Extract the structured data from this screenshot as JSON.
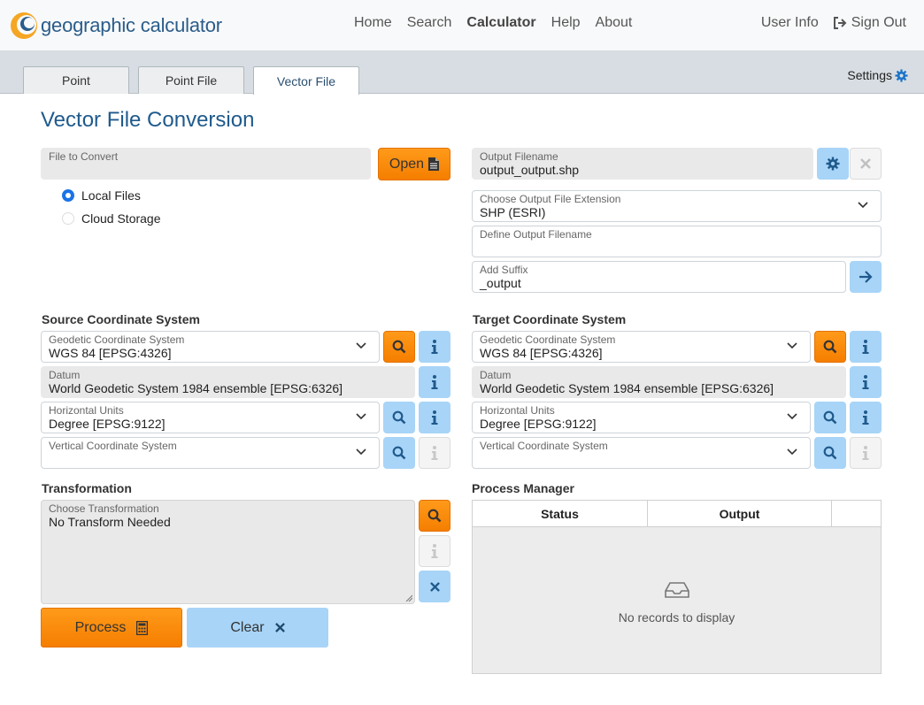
{
  "app": {
    "name": "geographic calculator"
  },
  "nav": {
    "links": [
      "Home",
      "Search",
      "Calculator",
      "Help",
      "About"
    ],
    "user_info": "User Info",
    "sign_out": "Sign Out"
  },
  "tabs": [
    {
      "label": "Point"
    },
    {
      "label": "Point File"
    },
    {
      "label": "Vector File",
      "active": true
    }
  ],
  "settings_label": "Settings",
  "page_title": "Vector File Conversion",
  "input": {
    "file_label": "File to Convert",
    "file_value": "",
    "open_label": "Open",
    "source_options": [
      {
        "label": "Local Files",
        "selected": true
      },
      {
        "label": "Cloud Storage",
        "selected": false
      }
    ]
  },
  "output": {
    "filename_label": "Output Filename",
    "filename_value": "output_output.shp",
    "extension_label": "Choose Output File Extension",
    "extension_value": "SHP (ESRI)",
    "define_label": "Define Output Filename",
    "define_value": "",
    "suffix_label": "Add Suffix",
    "suffix_value": "_output"
  },
  "source": {
    "heading": "Source Coordinate System",
    "geodetic_label": "Geodetic Coordinate System",
    "geodetic_value": "WGS 84 [EPSG:4326]",
    "datum_label": "Datum",
    "datum_value": "World Geodetic System 1984 ensemble [EPSG:6326]",
    "units_label": "Horizontal Units",
    "units_value": "Degree [EPSG:9122]",
    "vertical_label": "Vertical Coordinate System",
    "vertical_value": ""
  },
  "target": {
    "heading": "Target Coordinate System",
    "geodetic_label": "Geodetic Coordinate System",
    "geodetic_value": "WGS 84 [EPSG:4326]",
    "datum_label": "Datum",
    "datum_value": "World Geodetic System 1984 ensemble [EPSG:6326]",
    "units_label": "Horizontal Units",
    "units_value": "Degree [EPSG:9122]",
    "vertical_label": "Vertical Coordinate System",
    "vertical_value": ""
  },
  "transformation": {
    "heading": "Transformation",
    "choose_label": "Choose Transformation",
    "value": "No Transform Needed"
  },
  "actions": {
    "process": "Process",
    "clear": "Clear"
  },
  "process_manager": {
    "heading": "Process Manager",
    "columns": [
      "Status",
      "Output",
      ""
    ],
    "empty_text": "No records to display"
  },
  "colors": {
    "accent_orange": "#f57e00",
    "accent_blue": "#a8d4f7",
    "brand_blue": "#1f5a8c"
  }
}
